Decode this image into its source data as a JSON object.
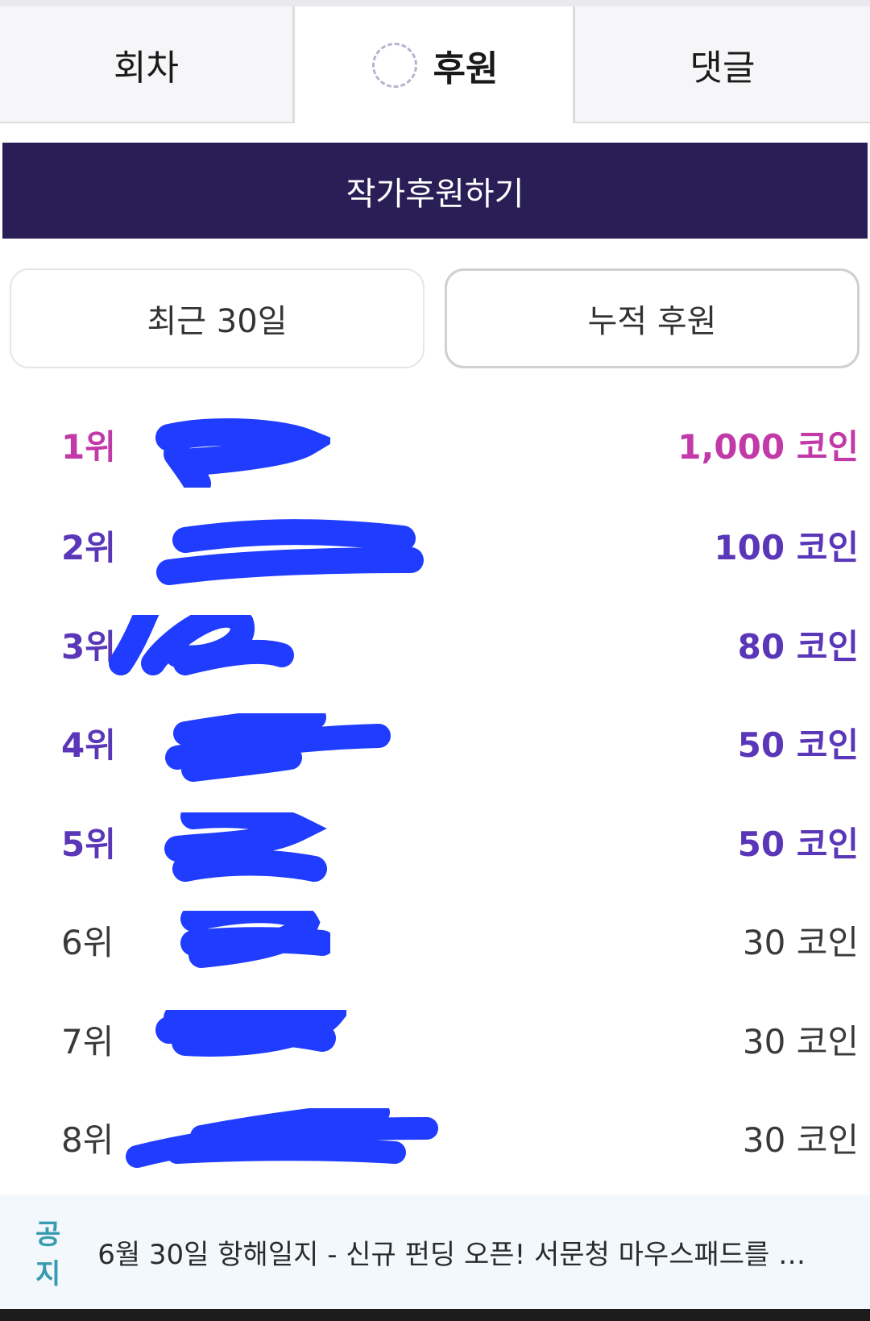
{
  "tabs": [
    {
      "label": "회차",
      "active": false
    },
    {
      "label": "후원",
      "active": true
    },
    {
      "label": "댓글",
      "active": false
    }
  ],
  "support_button": "작가후원하기",
  "filters": {
    "recent": "최근 30일",
    "total": "누적 후원"
  },
  "ranking": [
    {
      "rank": "1위",
      "amount": "1,000 코인"
    },
    {
      "rank": "2위",
      "amount": "100 코인"
    },
    {
      "rank": "3위",
      "amount": "80 코인"
    },
    {
      "rank": "4위",
      "amount": "50 코인"
    },
    {
      "rank": "5위",
      "amount": "50 코인"
    },
    {
      "rank": "6위",
      "amount": "30 코인"
    },
    {
      "rank": "7위",
      "amount": "30 코인"
    },
    {
      "rank": "8위",
      "amount": "30 코인"
    }
  ],
  "notice": {
    "tag": "공지",
    "text": "6월 30일 항해일지 - 신규 펀딩 오픈! 서문청 마우스패드를 …"
  },
  "colors": {
    "primary": "#2a1e57",
    "rank_first": "#c23aa8",
    "rank_top": "#5a37b8",
    "rank_default": "#3a3a3a",
    "redaction": "#1f3cff",
    "notice_tag": "#3a9ab3"
  }
}
